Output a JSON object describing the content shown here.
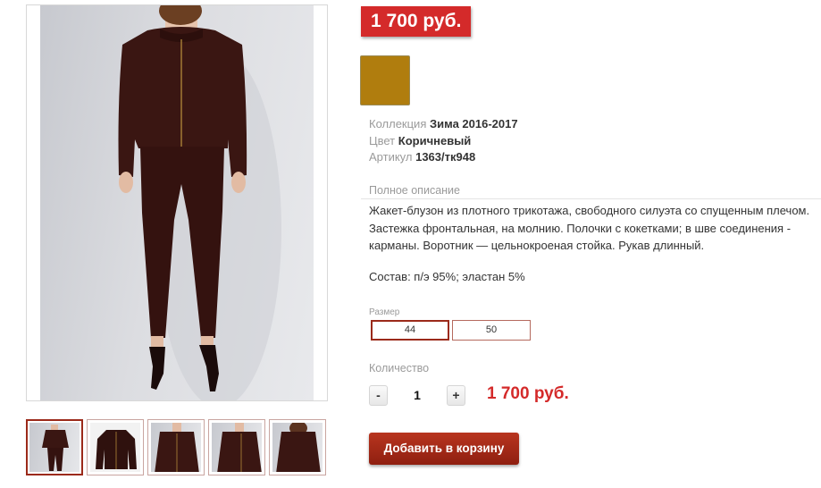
{
  "product": {
    "price_badge": "1 700 руб.",
    "swatch_color": "#b07d0e",
    "properties": [
      {
        "label": "Коллекция",
        "value": "Зима 2016-2017"
      },
      {
        "label": "Цвет",
        "value": "Коричневый"
      },
      {
        "label": "Артикул",
        "value": "1363/тк948"
      }
    ],
    "description_label": "Полное описание",
    "description_lines": [
      "Жакет-блузон из плотного трикотажа, свободного силуэта со спущенным плечом.",
      "Застежка фронтальная, на молнию. Полочки с кокетками; в шве соединения -",
      "карманы. Воротник — цельнокроеная стойка. Рукав длинный."
    ],
    "composition": "Состав: п/э 95%; эластан 5%",
    "size_label": "Размер",
    "sizes": [
      {
        "label": "44",
        "selected": true
      },
      {
        "label": "50",
        "selected": false
      }
    ],
    "quantity_label": "Количество",
    "quantity": {
      "minus": "-",
      "value": "1",
      "plus": "+"
    },
    "total_price": "1 700 руб.",
    "add_to_cart": "Добавить в корзину"
  },
  "gallery": {
    "thumbnail_count": 5,
    "active_index": 0,
    "garment_color": "#3a1612"
  }
}
